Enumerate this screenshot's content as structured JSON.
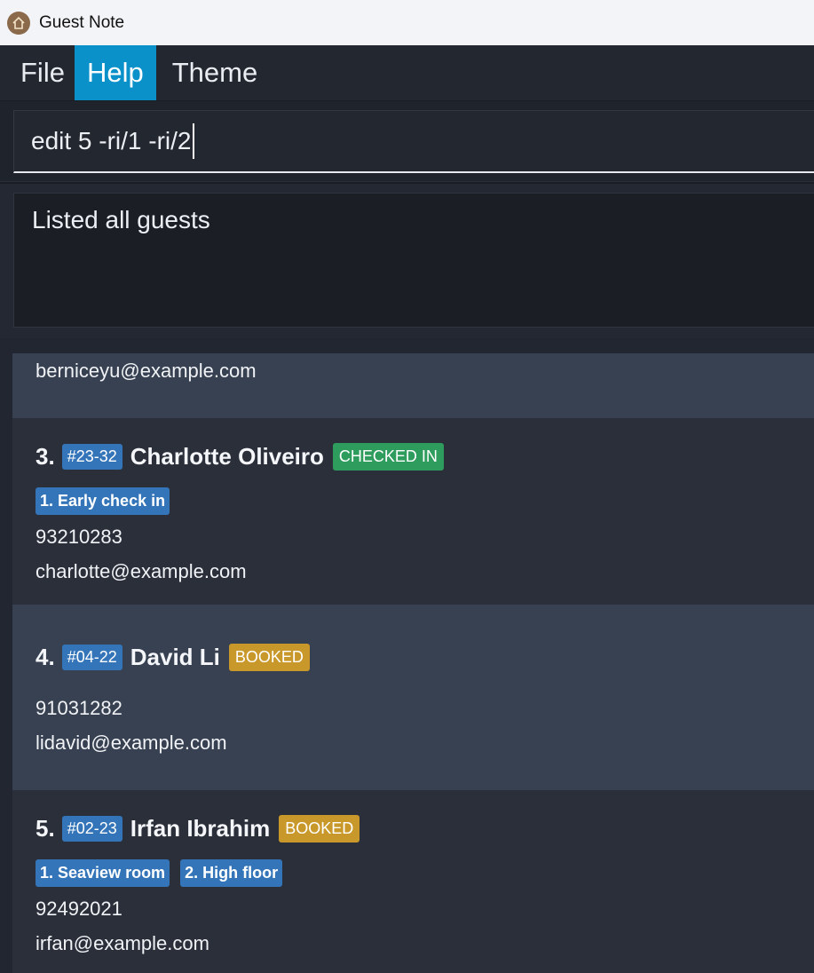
{
  "window": {
    "title": "Guest Note"
  },
  "menu": [
    {
      "label": "File"
    },
    {
      "label": "Help"
    },
    {
      "label": "Theme"
    }
  ],
  "command": {
    "value": "edit 5 -ri/1 -ri/2"
  },
  "result": {
    "text": "Listed all guests"
  },
  "guests": {
    "partial": {
      "email": "berniceyu@example.com"
    },
    "g3": {
      "index": "3.",
      "room": "#23-32",
      "name": "Charlotte Oliveiro",
      "status": "CHECKED IN",
      "requests": [
        "1. Early check in"
      ],
      "phone": "93210283",
      "email": "charlotte@example.com"
    },
    "g4": {
      "index": "4.",
      "room": "#04-22",
      "name": "David Li",
      "status": "BOOKED",
      "phone": "91031282",
      "email": "lidavid@example.com"
    },
    "g5": {
      "index": "5.",
      "room": "#02-23",
      "name": "Irfan Ibrahim",
      "status": "BOOKED",
      "requests": [
        "1. Seaview room",
        "2. High floor"
      ],
      "phone": "92492021",
      "email": "irfan@example.com"
    }
  },
  "colors": {
    "accent": "#0b91c9",
    "room_tag": "#3474b8",
    "checked_in": "#2e9c5c",
    "booked": "#c9982a"
  }
}
